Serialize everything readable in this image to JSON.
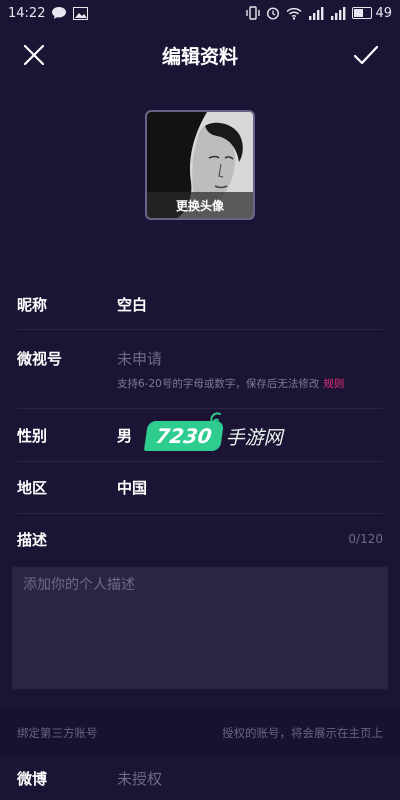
{
  "status_bar": {
    "time": "14:22",
    "battery": "49"
  },
  "header": {
    "title": "编辑资料"
  },
  "avatar": {
    "change_label": "更换头像"
  },
  "fields": {
    "nickname": {
      "label": "昵称",
      "value": "空白"
    },
    "weishi_id": {
      "label": "微视号",
      "placeholder": "未申请",
      "hint": "支持6-20号的字母或数字，保存后无法修改",
      "rule_link": "规则"
    },
    "gender": {
      "label": "性别",
      "value": "男"
    },
    "region": {
      "label": "地区",
      "value": "中国"
    },
    "description": {
      "label": "描述",
      "count": "0/120",
      "placeholder": "添加你的个人描述"
    }
  },
  "third_party": {
    "section_title": "绑定第三方账号",
    "section_note": "授权的账号，将会展示在主页上",
    "weibo": {
      "label": "微博",
      "value": "未授权"
    }
  },
  "watermark": {
    "number": "7230",
    "text": "手游网"
  },
  "colors": {
    "background": "#1c1434",
    "accent": "#e0307a",
    "watermark": "#2fcc8f"
  }
}
